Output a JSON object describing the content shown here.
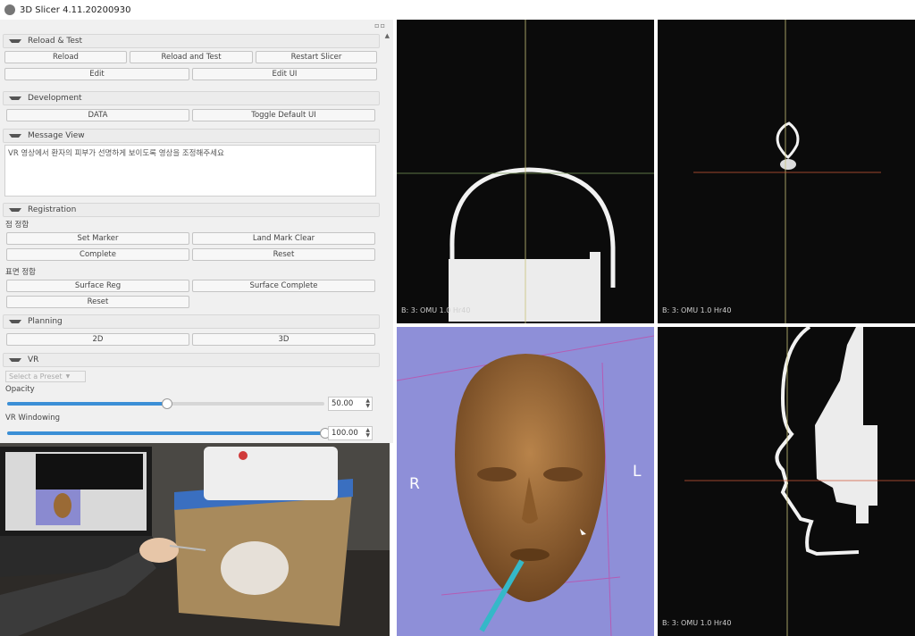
{
  "window": {
    "title": "3D Slicer 4.11.20200930"
  },
  "panel": {
    "sections": {
      "reload_test": "Reload & Test",
      "development": "Development",
      "message_view": "Message View",
      "registration": "Registration",
      "planning": "Planning",
      "vr": "VR"
    },
    "buttons": {
      "reload": "Reload",
      "reload_and_test": "Reload and Test",
      "restart_slicer": "Restart Slicer",
      "edit": "Edit",
      "edit_ui": "Edit UI",
      "data": "DATA",
      "toggle_default_ui": "Toggle Default UI",
      "set_marker": "Set Marker",
      "landmark_clear": "Land Mark Clear",
      "complete": "Complete",
      "reset_point": "Reset",
      "surface_reg": "Surface Reg",
      "surface_complete": "Surface Complete",
      "reset_surface": "Reset",
      "btn_2d": "2D",
      "btn_3d": "3D"
    },
    "message": "VR 영상에서 환자의 피부가 선명하게 보이도록 영상을 조정해주세요",
    "labels": {
      "point_registration": "점 정합",
      "surface_registration": "표면 정합",
      "opacity": "Opacity",
      "vr_windowing": "VR Windowing"
    },
    "preset_placeholder": "Select a Preset",
    "opacity_value": "50.00",
    "opacity_fraction": 0.5,
    "windowing_value": "100.00",
    "windowing_fraction": 1.0
  },
  "views": {
    "red_label": "B: 3: OMU 1.0 Hr40",
    "yellow_label": "B: 3: OMU 1.0 Hr40",
    "green_label": "B: 3: OMU 1.0 Hr40",
    "orientation": {
      "right": "R",
      "left": "L"
    }
  },
  "colors": {
    "slider_fill": "#3b8fd6",
    "view_bg": "#0b0b0b",
    "view3d_bg": "#8e8fd8",
    "face": "#9a6a35",
    "crosshair": "#c9c27a",
    "slice_line": "#d0583a",
    "probe": "#35b8c8"
  },
  "icons": [
    "app-icon",
    "collapse-arrow-icon",
    "spinbox-arrows-icon",
    "dock-controls-icon"
  ]
}
